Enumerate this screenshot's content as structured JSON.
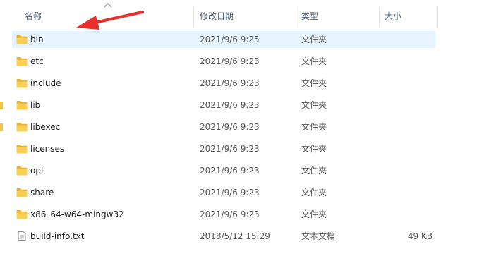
{
  "columns": {
    "name": "名称",
    "date": "修改日期",
    "type": "类型",
    "size": "大小"
  },
  "files": [
    {
      "name": "bin",
      "date": "2021/9/6 9:25",
      "type": "文件夹",
      "size": "",
      "icon": "folder-icon",
      "selected": true
    },
    {
      "name": "etc",
      "date": "2021/9/6 9:23",
      "type": "文件夹",
      "size": "",
      "icon": "folder-icon"
    },
    {
      "name": "include",
      "date": "2021/9/6 9:23",
      "type": "文件夹",
      "size": "",
      "icon": "folder-icon"
    },
    {
      "name": "lib",
      "date": "2021/9/6 9:23",
      "type": "文件夹",
      "size": "",
      "icon": "folder-icon"
    },
    {
      "name": "libexec",
      "date": "2021/9/6 9:23",
      "type": "文件夹",
      "size": "",
      "icon": "folder-icon"
    },
    {
      "name": "licenses",
      "date": "2021/9/6 9:23",
      "type": "文件夹",
      "size": "",
      "icon": "folder-icon"
    },
    {
      "name": "opt",
      "date": "2021/9/6 9:23",
      "type": "文件夹",
      "size": "",
      "icon": "folder-icon"
    },
    {
      "name": "share",
      "date": "2021/9/6 9:23",
      "type": "文件夹",
      "size": "",
      "icon": "folder-icon"
    },
    {
      "name": "x86_64-w64-mingw32",
      "date": "2021/9/6 9:23",
      "type": "文件夹",
      "size": "",
      "icon": "folder-icon"
    },
    {
      "name": "build-info.txt",
      "date": "2018/5/12 15:29",
      "type": "文本文档",
      "size": "49 KB",
      "icon": "text-file-icon"
    }
  ],
  "colors": {
    "selection": "#e5f3ff",
    "header_text": "#4c607a",
    "folder": "#f4c544",
    "annotation_arrow": "#e8302a"
  },
  "annotation": {
    "icon": "red-arrow-annotation"
  }
}
